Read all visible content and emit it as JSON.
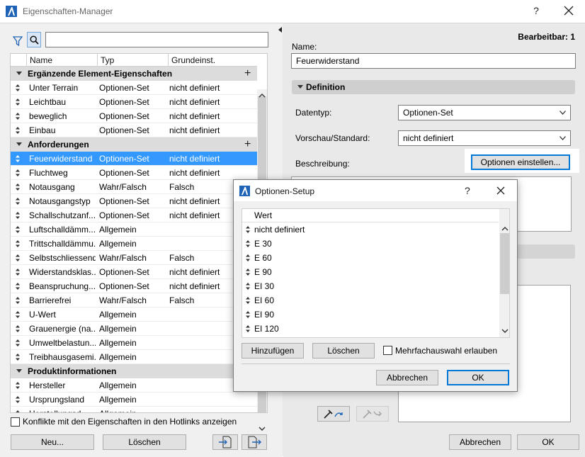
{
  "window": {
    "title": "Eigenschaften-Manager",
    "help": "?"
  },
  "left": {
    "search_placeholder": "",
    "columns": [
      "Name",
      "Typ",
      "Grundeinst."
    ],
    "rows": [
      {
        "kind": "group",
        "name": "Ergänzende Element-Eigenschaften",
        "plus": "+"
      },
      {
        "kind": "item",
        "name": "Unter Terrain",
        "type": "Optionen-Set",
        "default": "nicht definiert"
      },
      {
        "kind": "item",
        "name": "Leichtbau",
        "type": "Optionen-Set",
        "default": "nicht definiert"
      },
      {
        "kind": "item",
        "name": "beweglich",
        "type": "Optionen-Set",
        "default": "nicht definiert"
      },
      {
        "kind": "item",
        "name": "Einbau",
        "type": "Optionen-Set",
        "default": "nicht definiert"
      },
      {
        "kind": "group",
        "name": "Anforderungen",
        "plus": "+"
      },
      {
        "kind": "item",
        "name": "Feuerwiderstand",
        "type": "Optionen-Set",
        "default": "nicht definiert",
        "selected": true
      },
      {
        "kind": "item",
        "name": "Fluchtweg",
        "type": "Optionen-Set",
        "default": "nicht definiert"
      },
      {
        "kind": "item",
        "name": "Notausgang",
        "type": "Wahr/Falsch",
        "default": "Falsch"
      },
      {
        "kind": "item",
        "name": "Notausgangstyp",
        "type": "Optionen-Set",
        "default": "nicht definiert"
      },
      {
        "kind": "item",
        "name": "Schallschutzanf...",
        "type": "Optionen-Set",
        "default": "nicht definiert"
      },
      {
        "kind": "item",
        "name": "Luftschalldämm...",
        "type": "Allgemein",
        "default": ""
      },
      {
        "kind": "item",
        "name": "Trittschalldämmu...",
        "type": "Allgemein",
        "default": ""
      },
      {
        "kind": "item",
        "name": "Selbstschliessend",
        "type": "Wahr/Falsch",
        "default": "Falsch"
      },
      {
        "kind": "item",
        "name": "Widerstandsklas...",
        "type": "Optionen-Set",
        "default": "nicht definiert"
      },
      {
        "kind": "item",
        "name": "Beanspruchung...",
        "type": "Optionen-Set",
        "default": "nicht definiert"
      },
      {
        "kind": "item",
        "name": "Barrierefrei",
        "type": "Wahr/Falsch",
        "default": "Falsch"
      },
      {
        "kind": "item",
        "name": "U-Wert",
        "type": "Allgemein",
        "default": ""
      },
      {
        "kind": "item",
        "name": "Grauenergie (na...",
        "type": "Allgemein",
        "default": ""
      },
      {
        "kind": "item",
        "name": "Umweltbelastun...",
        "type": "Allgemein",
        "default": ""
      },
      {
        "kind": "item",
        "name": "Treibhausgasemi...",
        "type": "Allgemein",
        "default": ""
      },
      {
        "kind": "group",
        "name": "Produktinformationen",
        "plus": ""
      },
      {
        "kind": "item",
        "name": "Hersteller",
        "type": "Allgemein",
        "default": ""
      },
      {
        "kind": "item",
        "name": "Ursprungsland",
        "type": "Allgemein",
        "default": ""
      },
      {
        "kind": "item",
        "name": "Herstellungsd...",
        "type": "Allgemein",
        "default": ""
      }
    ],
    "conflicts_label": "Konflikte mit den Eigenschaften in den Hotlinks anzeigen",
    "new_label": "Neu...",
    "delete_label": "Löschen"
  },
  "right": {
    "editable": "Bearbeitbar: 1",
    "name_label": "Name:",
    "name_value": "Feuerwiderstand",
    "definition_label": "Definition",
    "datatype_label": "Datentyp:",
    "datatype_value": "Optionen-Set",
    "preview_label": "Vorschau/Standard:",
    "preview_value": "nicht definiert",
    "description_label": "Beschreibung:",
    "options_button": "Optionen einstellen...",
    "cancel_label": "Abbrechen",
    "ok_label": "OK"
  },
  "dialog": {
    "title": "Optionen-Setup",
    "help": "?",
    "column": "Wert",
    "values": [
      "nicht definiert",
      "E 30",
      "E 60",
      "E 90",
      "EI 30",
      "EI 60",
      "EI 90",
      "EI 120"
    ],
    "add_label": "Hinzufügen",
    "delete_label": "Löschen",
    "multi_label": "Mehrfachauswahl erlauben",
    "cancel_label": "Abbrechen",
    "ok_label": "OK"
  },
  "colors": {
    "selection": "#3399ff",
    "group_bg": "#dcdcdc",
    "accent": "#0078d7",
    "logo": "#1e63b5"
  }
}
